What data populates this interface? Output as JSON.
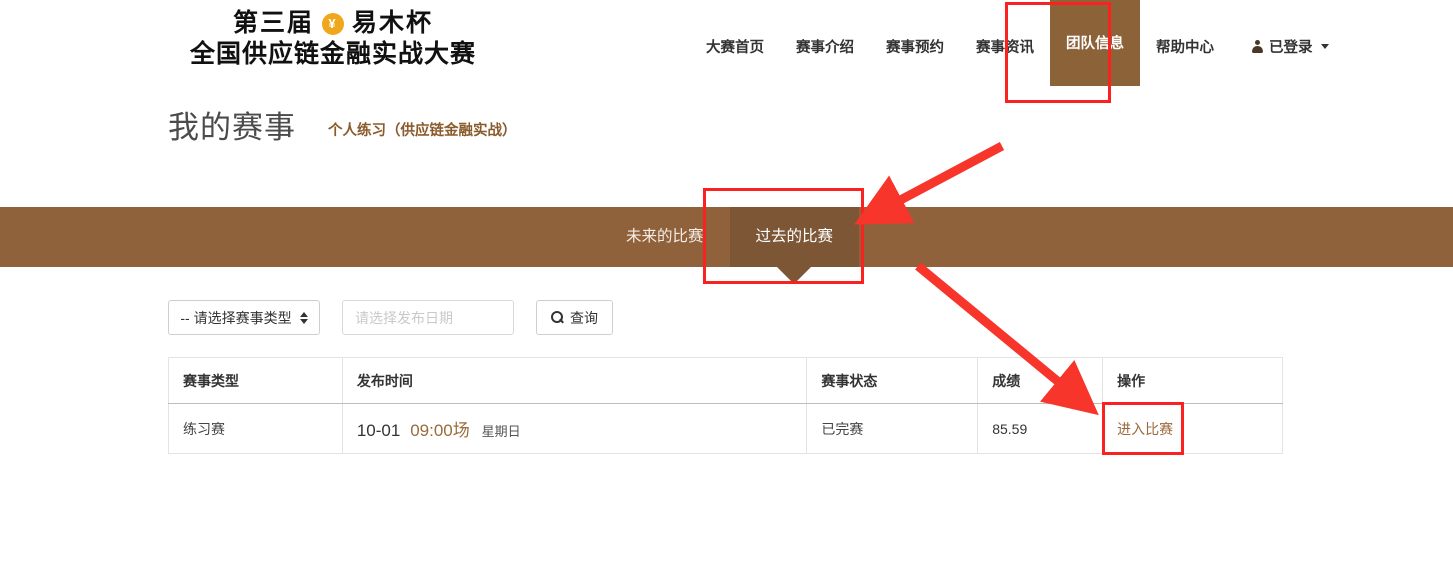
{
  "brand": {
    "line1_prefix": "第三届",
    "coin_symbol": "¥",
    "coin_icon": "coin-yen-icon",
    "line1_suffix": "易木杯",
    "line2": "全国供应链金融实战大赛",
    "coin_color": "#efa81d"
  },
  "nav": {
    "items": [
      {
        "label": "大赛首页",
        "active": false
      },
      {
        "label": "赛事介绍",
        "active": false
      },
      {
        "label": "赛事预约",
        "active": false
      },
      {
        "label": "赛事资讯",
        "active": false
      },
      {
        "label": "团队信息",
        "active": true
      },
      {
        "label": "帮助中心",
        "active": false
      }
    ],
    "user": {
      "label": "已登录",
      "icon": "person-icon",
      "caret": "chevron-down-icon"
    },
    "active_color": "#8c6239"
  },
  "page": {
    "title": "我的赛事",
    "subtitle": "个人练习（供应链金融实战）",
    "subtitle_color": "#8a5a2b"
  },
  "tabs": {
    "bar_color": "#90623b",
    "active_color": "#7c5635",
    "items": [
      {
        "label": "未来的比赛",
        "active": false
      },
      {
        "label": "过去的比赛",
        "active": true
      }
    ]
  },
  "filters": {
    "type_select": {
      "value": "-- 请选择赛事类型",
      "icon": "spinner-updown-icon"
    },
    "date_input": {
      "value": "",
      "placeholder": "请选择发布日期"
    },
    "search_button": {
      "label": "查询",
      "icon": "search-icon"
    }
  },
  "table": {
    "columns": [
      "赛事类型",
      "发布时间",
      "赛事状态",
      "成绩",
      "操作"
    ],
    "rows": [
      {
        "type": "练习赛",
        "time_date": "10-01",
        "time_slot": "09:00场",
        "time_week": "星期日",
        "state": "已完赛",
        "score": "85.59",
        "action": "进入比赛"
      }
    ]
  },
  "annotations": {
    "color": "#fb2121",
    "boxes": [
      {
        "target": "团队信息"
      },
      {
        "target": "过去的比赛"
      },
      {
        "target": "进入比赛"
      }
    ],
    "arrows": [
      {
        "from": "右上",
        "to": "过去的比赛"
      },
      {
        "from": "左上",
        "to": "成绩/进入比赛"
      }
    ]
  }
}
